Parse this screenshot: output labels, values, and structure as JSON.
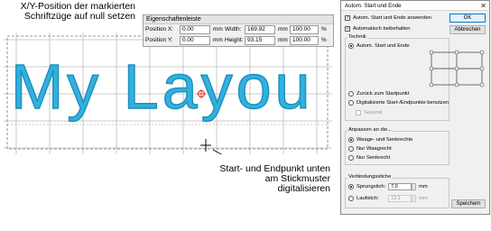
{
  "callouts": {
    "top": "X/Y-Position der markierten Schriftzüge auf null setzen",
    "bottom": "Start- und Endpunkt unten am Stickmuster digitalisieren"
  },
  "canvas": {
    "text": "My Layou",
    "text_color": "#33b0dc",
    "grid_color": "#bdbdbd",
    "marker_color": "#e02020"
  },
  "propbar": {
    "title": "Eigenschaftenleiste",
    "pos_x_label": "Position X:",
    "pos_x_value": "0.00",
    "pos_y_label": "Position Y:",
    "pos_y_value": "0.00",
    "unit": "mm",
    "width_label": "Width:",
    "width_value": "169.92",
    "height_label": "Height:",
    "height_value": "93.15",
    "scale_x": "100.00",
    "scale_y": "100.00",
    "percent": "%"
  },
  "dialog": {
    "title": "Autom. Start und Ende",
    "close": "✕",
    "cb_auto": "Autom. Start und Ende anwenden",
    "cb_keep": "Automatisch beibehalten",
    "ok": "OK",
    "cancel": "Abbrechen",
    "technik_label": "Technik",
    "radio_auto": "Autom. Start und Ende",
    "radio_back": "Zurück zum Startpunkt",
    "radio_digit": "Digitalisierte Start-/Endpunkte benutzen",
    "cb_separat": "Separat",
    "anpassen_label": "Anpassen an die...",
    "radio_ws": "Waage- und Senkrechte",
    "radio_w": "Nur Waagrecht",
    "radio_s": "Nur Senkrecht",
    "verbindung_label": "Verbindungsstiche",
    "radio_sprung": "Sprungstich:",
    "sprung_value": "7.0",
    "radio_lauf": "Laufstich:",
    "lauf_value": "12.1",
    "unit": "mm",
    "save": "Speichern"
  }
}
